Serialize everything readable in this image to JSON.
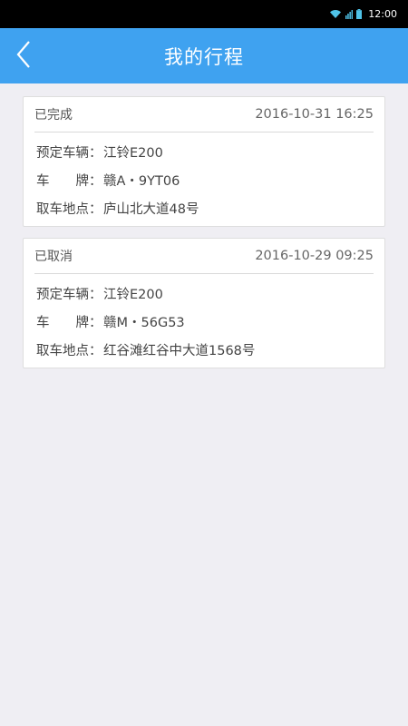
{
  "status_bar": {
    "time": "12:00"
  },
  "nav": {
    "title": "我的行程"
  },
  "trips": [
    {
      "status": "已完成",
      "datetime": "2016-10-31 16:25",
      "vehicle_label": "预定车辆：",
      "vehicle": "江铃E200",
      "plate_label": "车　　牌：",
      "plate": "赣A・9YT06",
      "pickup_label": "取车地点：",
      "pickup": "庐山北大道48号"
    },
    {
      "status": "已取消",
      "datetime": "2016-10-29 09:25",
      "vehicle_label": "预定车辆：",
      "vehicle": "江铃E200",
      "plate_label": "车　　牌：",
      "plate": "赣M・56G53",
      "pickup_label": "取车地点：",
      "pickup": "红谷滩红谷中大道1568号"
    }
  ]
}
